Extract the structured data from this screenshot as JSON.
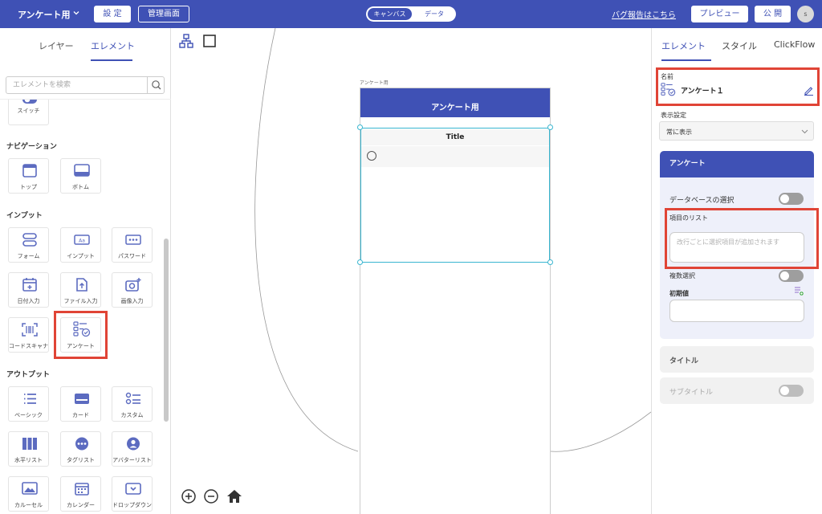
{
  "header": {
    "app_name": "アンケート用",
    "settings_button": "設 定",
    "admin_button": "管理画面",
    "mode_toggle": {
      "canvas": "キャンバス",
      "data": "データ"
    },
    "bug_report_link": "バグ報告はこちら",
    "preview_button": "プレビュー",
    "publish_button": "公 開",
    "avatar_initial": "s"
  },
  "left_panel": {
    "tabs": [
      "レイヤー",
      "エレメント"
    ],
    "active_tab": "エレメント",
    "search_placeholder": "エレメントを検索",
    "partial_item": {
      "label": "スイッチ",
      "icon": "switch-icon"
    },
    "sections": [
      {
        "title": "ナビゲーション",
        "items": [
          {
            "label": "トップ",
            "icon": "top-nav-icon"
          },
          {
            "label": "ボトム",
            "icon": "bottom-nav-icon"
          }
        ]
      },
      {
        "title": "インプット",
        "items": [
          {
            "label": "フォーム",
            "icon": "form-icon"
          },
          {
            "label": "インプット",
            "icon": "input-icon"
          },
          {
            "label": "パスワード",
            "icon": "password-icon"
          },
          {
            "label": "日付入力",
            "icon": "date-input-icon"
          },
          {
            "label": "ファイル入力",
            "icon": "file-input-icon"
          },
          {
            "label": "画像入力",
            "icon": "image-input-icon"
          },
          {
            "label": "コードスキャナ",
            "icon": "code-scanner-icon"
          },
          {
            "label": "アンケート",
            "icon": "survey-icon",
            "highlighted": true
          }
        ]
      },
      {
        "title": "アウトプット",
        "items": [
          {
            "label": "ベーシック",
            "icon": "basic-list-icon"
          },
          {
            "label": "カード",
            "icon": "card-icon"
          },
          {
            "label": "カスタム",
            "icon": "custom-list-icon"
          },
          {
            "label": "水平リスト",
            "icon": "horizontal-list-icon"
          },
          {
            "label": "タグリスト",
            "icon": "tag-list-icon"
          },
          {
            "label": "アバターリスト",
            "icon": "avatar-list-icon"
          },
          {
            "label": "カルーセル",
            "icon": "carousel-icon"
          },
          {
            "label": "カレンダー",
            "icon": "calendar-icon"
          },
          {
            "label": "ドロップダウン",
            "icon": "dropdown-icon"
          }
        ]
      }
    ]
  },
  "canvas": {
    "screen_name": "アンケート用",
    "phone_header_title": "アンケート用",
    "survey_title": "Title",
    "tools": [
      "sitemap-icon",
      "frame-icon"
    ],
    "zoom_controls": [
      "zoom-in-icon",
      "zoom-out-icon",
      "home-icon"
    ]
  },
  "right_panel": {
    "tabs": [
      "エレメント",
      "スタイル",
      "ClickFlow"
    ],
    "active_tab": "エレメント",
    "name_label": "名前",
    "element_name": "アンケート１",
    "display_setting_label": "表示設定",
    "display_setting_value": "常に表示",
    "survey_card": {
      "title": "アンケート",
      "database_select_label": "データベースの選択",
      "database_select_on": false,
      "item_list_label": "項目のリスト",
      "item_list_placeholder": "改行ごとに選択項目が追加されます",
      "item_list_value": "",
      "multi_select_label": "複数選択",
      "multi_select_on": false,
      "initial_value_label": "初期値",
      "initial_value": ""
    },
    "title_section": "タイトル",
    "subtitle_section": "サブタイトル",
    "subtitle_on": false
  },
  "colors": {
    "primary": "#3f51b5",
    "highlight_box": "#e04436",
    "selection": "#39b6d0"
  }
}
